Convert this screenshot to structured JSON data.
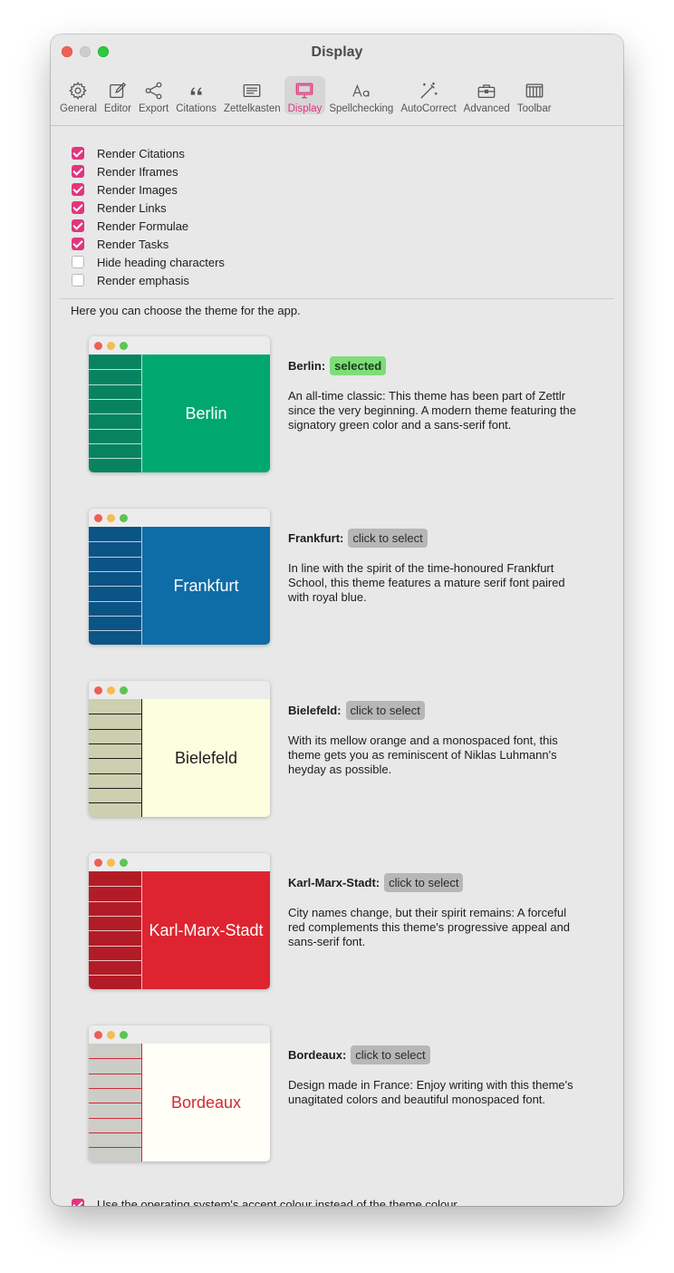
{
  "window": {
    "title": "Display"
  },
  "toolbar": {
    "tabs": [
      {
        "id": "general",
        "label": "General",
        "icon": "gear-icon",
        "active": false
      },
      {
        "id": "editor",
        "label": "Editor",
        "icon": "pencil-square-icon",
        "active": false
      },
      {
        "id": "export",
        "label": "Export",
        "icon": "share-icon",
        "active": false
      },
      {
        "id": "citations",
        "label": "Citations",
        "icon": "quote-icon",
        "active": false
      },
      {
        "id": "zettelkasten",
        "label": "Zettelkasten",
        "icon": "text-box-icon",
        "active": false
      },
      {
        "id": "display",
        "label": "Display",
        "icon": "monitor-icon",
        "active": true
      },
      {
        "id": "spellchecking",
        "label": "Spellchecking",
        "icon": "text-aa-icon",
        "active": false
      },
      {
        "id": "autocorrect",
        "label": "AutoCorrect",
        "icon": "magic-wand-icon",
        "active": false
      },
      {
        "id": "advanced",
        "label": "Advanced",
        "icon": "toolbox-icon",
        "active": false
      },
      {
        "id": "toolbar",
        "label": "Toolbar",
        "icon": "columns-icon",
        "active": false
      }
    ]
  },
  "settings": {
    "checkboxes": [
      {
        "label": "Render Citations",
        "checked": true
      },
      {
        "label": "Render Iframes",
        "checked": true
      },
      {
        "label": "Render Images",
        "checked": true
      },
      {
        "label": "Render Links",
        "checked": true
      },
      {
        "label": "Render Formulae",
        "checked": true
      },
      {
        "label": "Render Tasks",
        "checked": true
      },
      {
        "label": "Hide heading characters",
        "checked": false
      },
      {
        "label": "Render emphasis",
        "checked": false
      }
    ]
  },
  "themes": {
    "intro": "Here you can choose the theme for the app.",
    "items": [
      {
        "id": "berlin",
        "name": "Berlin:",
        "preview_name": "Berlin",
        "status": "selected",
        "selected": true,
        "description": "An all-time classic: This theme has been part of Zettlr since the very beginning. A modern theme featuring the signatory green color and a sans-serif font.",
        "colors": {
          "sidebar": "#078360",
          "main": "#00a870",
          "text": "#ffffff",
          "lines": "#b4e3d2"
        },
        "font": "sans"
      },
      {
        "id": "frankfurt",
        "name": "Frankfurt:",
        "preview_name": "Frankfurt",
        "status": "click to select",
        "selected": false,
        "description": "In line with the spirit of the time-honoured Frankfurt School, this theme features a mature serif font paired with royal blue.",
        "colors": {
          "sidebar": "#0a5486",
          "main": "#0e6ca7",
          "text": "#ffffff",
          "lines": "#b8cee0"
        },
        "font": "serif"
      },
      {
        "id": "bielefeld",
        "name": "Bielefeld:",
        "preview_name": "Bielefeld",
        "status": "click to select",
        "selected": false,
        "description": "With its mellow orange and a monospaced font, this theme gets you as reminiscent of Niklas Luhmann's heyday as possible.",
        "colors": {
          "sidebar": "#cccfb0",
          "main": "#fdfedf",
          "text": "#1d1d1d",
          "lines": "#1d1d1d"
        },
        "font": "mono"
      },
      {
        "id": "karl-marx-stadt",
        "name": "Karl-Marx-Stadt:",
        "preview_name": "Karl-Marx-Stadt",
        "status": "click to select",
        "selected": false,
        "description": "City names change, but their spirit remains: A forceful red complements this theme's progressive appeal and sans-serif font.",
        "colors": {
          "sidebar": "#b21c27",
          "main": "#de2430",
          "text": "#ffffff",
          "lines": "#efc0c3"
        },
        "font": "sans"
      },
      {
        "id": "bordeaux",
        "name": "Bordeaux:",
        "preview_name": "Bordeaux",
        "status": "click to select",
        "selected": false,
        "description": "Design made in France: Enjoy writing with this theme's unagitated colors and beautiful monospaced font.",
        "colors": {
          "sidebar": "#cdcdc8",
          "main": "#fffff8",
          "text": "#d02a35",
          "lines": "#d02a35"
        },
        "font": "mono"
      }
    ]
  },
  "footer": {
    "accent_label": "Use the operating system's accent colour instead of the theme colour",
    "accent_checked": true
  },
  "accent_color": "#e0367e"
}
